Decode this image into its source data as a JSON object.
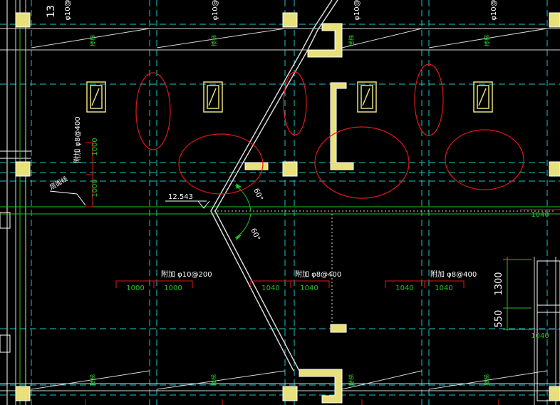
{
  "drawing": {
    "background": "#000000",
    "colors": {
      "grid_dashed": "#17c8c8",
      "beam_line": "#d8d8d8",
      "column_fill": "#e8e07a",
      "red": "#e01818",
      "green": "#26c026",
      "white": "#ffffff",
      "yellow": "#f0f060"
    },
    "top_rebar_labels": [
      "φ10@",
      "φ10@",
      "φ10@",
      "φ10@"
    ],
    "top_partial_number": "13",
    "rebar_notes": {
      "left_vertical": "附加 φ8@400",
      "bottom_left": "附加 φ10@200",
      "bottom_mid": "附加 φ8@400",
      "bottom_right": "附加 φ8@400"
    },
    "dimensions": {
      "left_upper": "1000",
      "left_lower": "1000",
      "left_pair": [
        "1000",
        "1000"
      ],
      "mid_pair": [
        "1040",
        "1040"
      ],
      "right_pair": [
        "1040",
        "1040"
      ],
      "right_edge_upper": "1040",
      "right_edge_lower": "1040",
      "vertical_1300": "1300",
      "vertical_550": "550"
    },
    "elevation": "12.543",
    "angles": [
      "60°",
      "60°"
    ],
    "floor_line_label": "层面线",
    "panel_labels": [
      "楼梯",
      "楼梯",
      "楼梯",
      "楼梯",
      "楼梯",
      "楼梯",
      "楼梯",
      "楼梯",
      "楼梯"
    ]
  }
}
